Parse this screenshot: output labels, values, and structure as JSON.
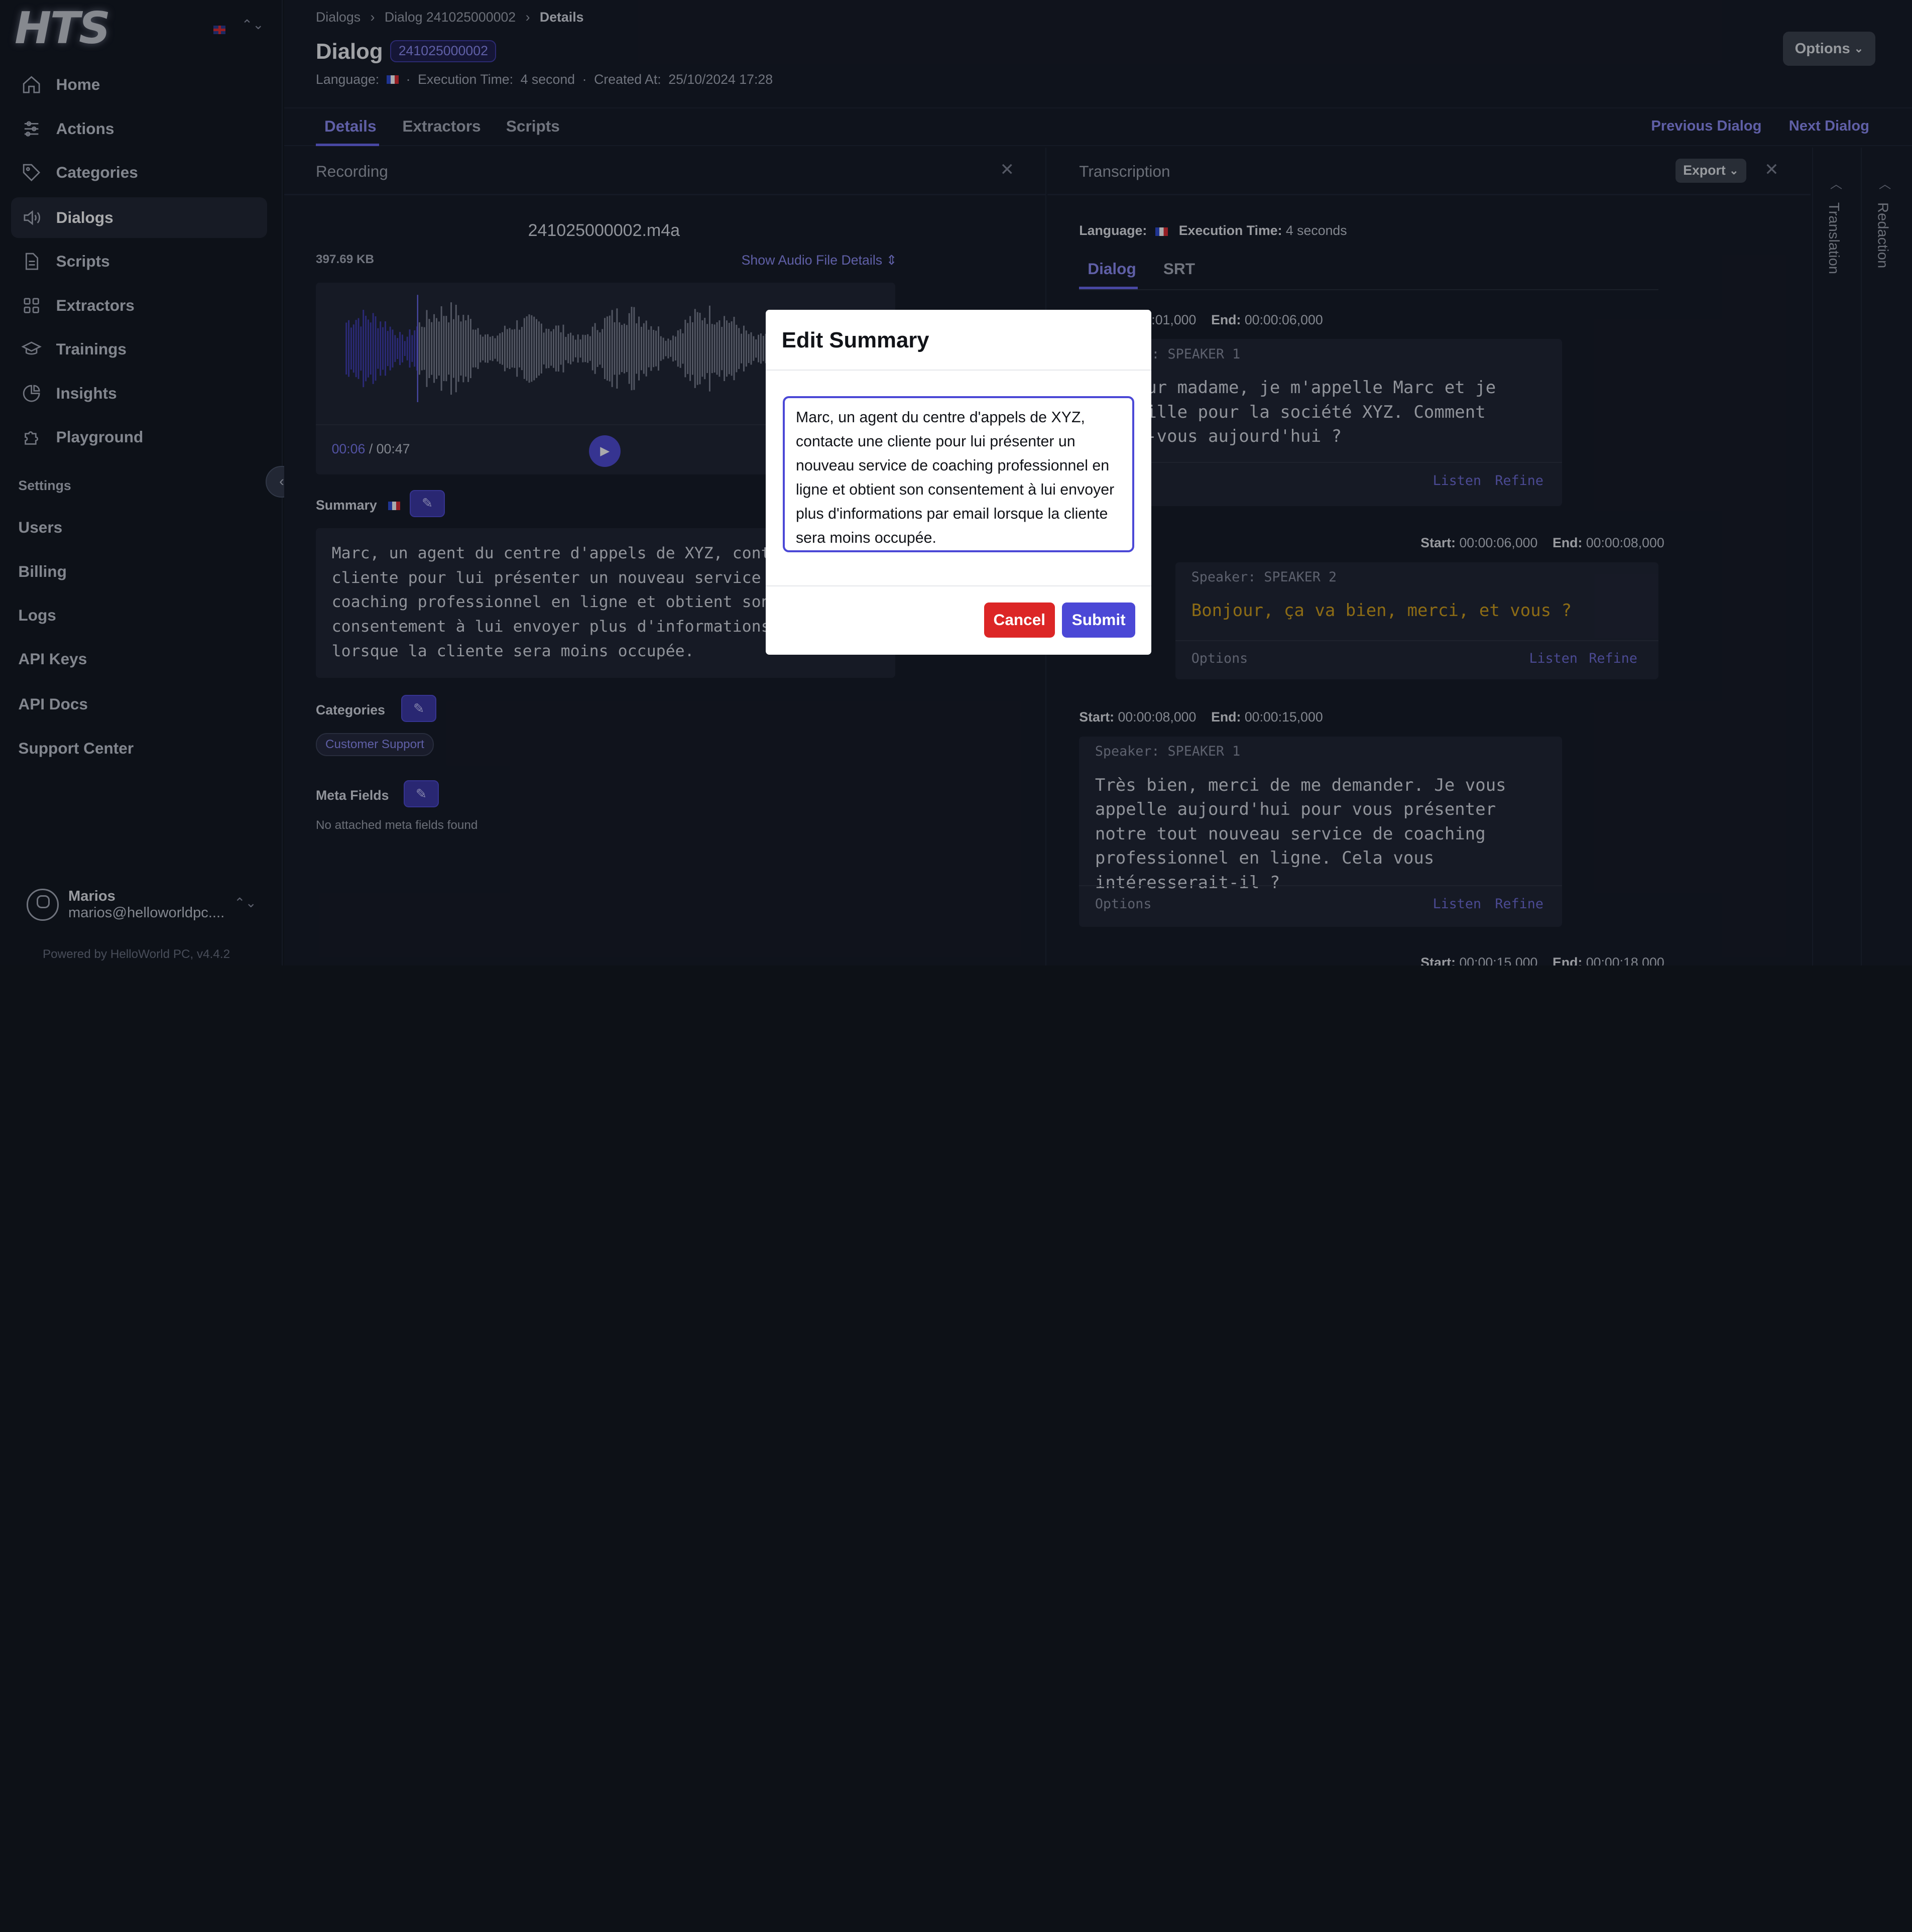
{
  "app": {
    "logo": "HTS",
    "powered_by": "Powered by HelloWorld PC, v4.4.2"
  },
  "sidebar": {
    "items": [
      {
        "label": "Home",
        "icon": "home-icon"
      },
      {
        "label": "Actions",
        "icon": "sliders-icon"
      },
      {
        "label": "Categories",
        "icon": "tag-icon"
      },
      {
        "label": "Dialogs",
        "icon": "speaker-icon",
        "active": true
      },
      {
        "label": "Scripts",
        "icon": "document-icon"
      },
      {
        "label": "Extractors",
        "icon": "grid-icon"
      },
      {
        "label": "Trainings",
        "icon": "graduation-cap-icon"
      },
      {
        "label": "Insights",
        "icon": "pie-chart-icon"
      },
      {
        "label": "Playground",
        "icon": "puzzle-icon"
      }
    ],
    "settings_heading": "Settings",
    "settings_items": [
      "Users",
      "Billing",
      "Logs",
      "API Keys",
      "API Docs",
      "Support Center"
    ],
    "user": {
      "name": "Marios",
      "email": "marios@helloworldpc...."
    }
  },
  "header": {
    "breadcrumbs": [
      "Dialogs",
      "Dialog 241025000002",
      "Details"
    ],
    "title": "Dialog",
    "id_badge": "241025000002",
    "language_label": "Language:",
    "execution_label": "Execution Time:",
    "execution_value": "4 second",
    "created_label": "Created At:",
    "created_value": "25/10/2024 17:28",
    "options_label": "Options",
    "separator": "·"
  },
  "tabs": [
    "Details",
    "Extractors",
    "Scripts"
  ],
  "nav_links": {
    "previous": "Previous Dialog",
    "next": "Next Dialog"
  },
  "recording": {
    "title": "Recording",
    "file_name": "241025000002.m4a",
    "file_size": "397.69 KB",
    "details_link": "Show Audio File Details",
    "time_current": "00:06",
    "time_total": "/ 00:47",
    "progress": 0.13
  },
  "summary": {
    "label": "Summary",
    "text": "Marc, un agent du centre d'appels de XYZ, contacte une\ncliente pour lui présenter un nouveau service de\ncoaching professionnel en ligne et obtient son\nconsentement à lui envoyer plus d'informations par email\nlorsque la cliente sera moins occupée."
  },
  "categories": {
    "label": "Categories",
    "chips": [
      "Customer Support"
    ]
  },
  "meta_fields": {
    "label": "Meta Fields",
    "empty": "No attached meta fields found"
  },
  "transcription": {
    "title": "Transcription",
    "export_label": "Export",
    "language_label": "Language:",
    "execution_label": "Execution Time:",
    "execution_value": "4 seconds",
    "tabs": [
      "Dialog",
      "SRT"
    ],
    "start_label": "Start:",
    "end_label": "End:",
    "options_label": "Options",
    "listen_label": "Listen",
    "refine_label": "Refine",
    "segments": [
      {
        "start": "00:00:01,000",
        "end": "00:00:06,000",
        "speaker": "Speaker: SPEAKER 1",
        "text": "Bonjour madame, je m'appelle Marc et je travaille pour la société XYZ. Comment allez-vous aujourd'hui ?"
      },
      {
        "start": "00:00:06,000",
        "end": "00:00:08,000",
        "speaker": "Speaker: SPEAKER 2",
        "text": "Bonjour, ça va bien, merci, et vous ?"
      },
      {
        "start": "00:00:08,000",
        "end": "00:00:15,000",
        "speaker": "Speaker: SPEAKER 1",
        "text": "Très bien, merci de me demander. Je vous appelle aujourd'hui pour vous présenter notre tout nouveau service de coaching professionnel en ligne. Cela vous intéresserait-il ?"
      },
      {
        "start": "00:00:15,000",
        "end": "00:00:18,000"
      }
    ]
  },
  "rails": {
    "translation": "Translation",
    "redaction": "Redaction"
  },
  "modal": {
    "title": "Edit Summary",
    "value": "Marc, un agent du centre d'appels de XYZ, contacte une cliente pour lui présenter un nouveau service de coaching professionnel en ligne et obtient son consentement à lui envoyer plus d'informations par email lorsque la cliente sera moins occupée.",
    "cancel_label": "Cancel",
    "submit_label": "Submit"
  },
  "colors": {
    "accent": "#4b48d6",
    "danger": "#dc2626",
    "speaker2_text": "#d4a017"
  }
}
